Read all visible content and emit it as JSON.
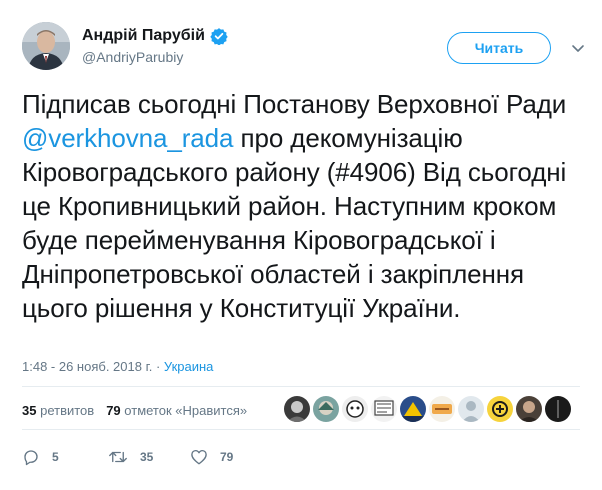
{
  "author": {
    "name": "Андрій Парубій",
    "handle": "@AndriyParubiy",
    "avatar_icon": "person-portrait-avatar",
    "verified_icon": "verified-badge-icon"
  },
  "follow_button": {
    "label": "Читать"
  },
  "tweet": {
    "text_before": "Підписав сьогодні Постанову Верховної Ради ",
    "mention": "@verkhovna_rada",
    "text_after": " про декомунізацію Кіровоградського району (#4906) Від сьогодні це Кропивницький район. Наступним кроком буде перейменування Кіровоградської і Дніпропетровської областей і закріплення цього рішення у Конституції України."
  },
  "meta": {
    "time_date": "1:48 - 26 нояб. 2018 г.",
    "place": "Украина"
  },
  "stats": {
    "retweets_count": "35",
    "retweets_label": "ретвитов",
    "likes_count": "79",
    "likes_label": "отметок «Нравится»"
  },
  "actions": {
    "replies": "5",
    "retweets": "35",
    "likes": "79"
  },
  "colors": {
    "accent": "#1da1f2",
    "link": "#1b95e0",
    "muted": "#657786",
    "divider": "#e6ecf0"
  }
}
